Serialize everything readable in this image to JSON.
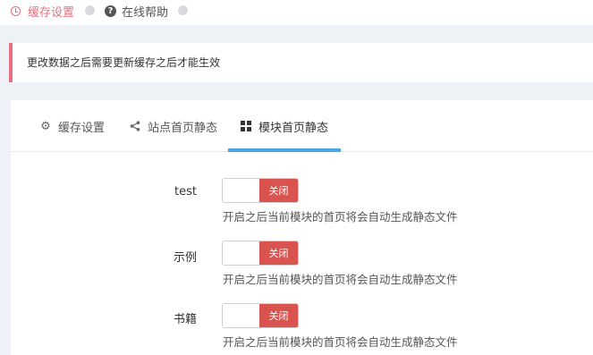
{
  "breadcrumbs": [
    {
      "label": "缓存设置",
      "icon": "clock-icon",
      "color": "#e5707f"
    },
    {
      "label": "在线帮助",
      "icon": "help-circle-icon"
    }
  ],
  "alert": {
    "text": "更改数据之后需要更新缓存之后才能生效",
    "accent": "#e5707f"
  },
  "tabs": [
    {
      "label": "缓存设置",
      "icon": "gear-icon",
      "active": false
    },
    {
      "label": "站点首页静态",
      "icon": "share-icon",
      "active": false
    },
    {
      "label": "模块首页静态",
      "icon": "grid-icon",
      "active": true
    }
  ],
  "modules": [
    {
      "label": "test",
      "switch_label": "关闭",
      "state": "off",
      "help": "开启之后当前模块的首页将会自动生成静态文件"
    },
    {
      "label": "示例",
      "switch_label": "关闭",
      "state": "off",
      "help": "开启之后当前模块的首页将会自动生成静态文件"
    },
    {
      "label": "书籍",
      "switch_label": "关闭",
      "state": "off",
      "help": "开启之后当前模块的首页将会自动生成静态文件"
    }
  ],
  "colors": {
    "active_tab_underline": "#4aa6e0",
    "switch_off": "#d9534f"
  }
}
